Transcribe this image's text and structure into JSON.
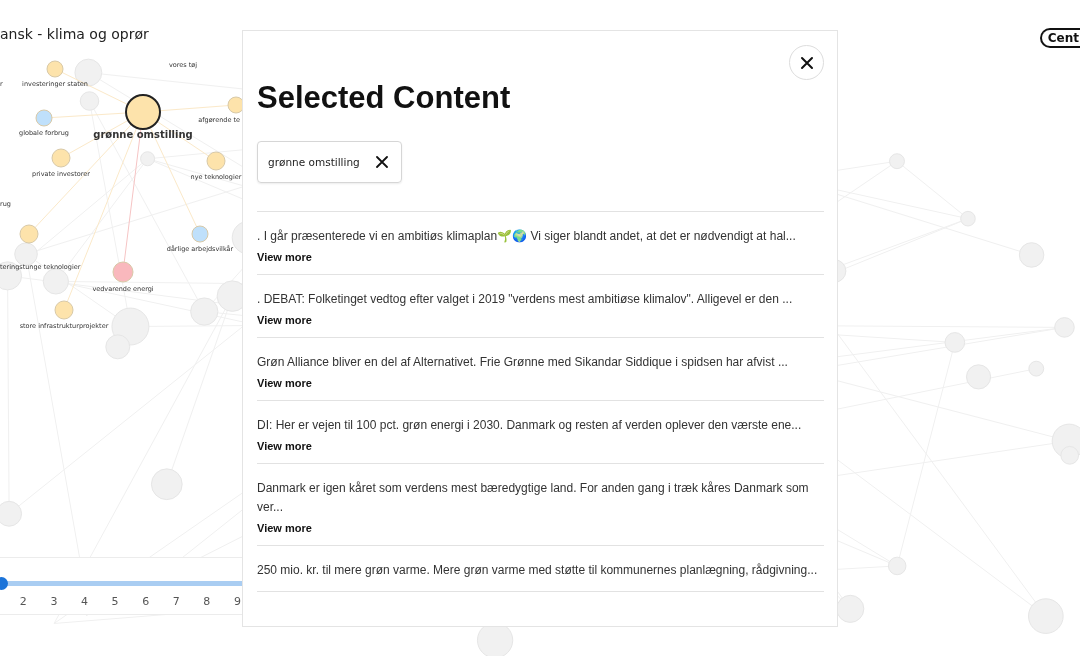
{
  "page_title": "ansk - klima og oprør",
  "center_button": "Cent",
  "graph": {
    "nodes": [
      {
        "label": "investeringer staten",
        "color": "#fde3ab",
        "selected": false
      },
      {
        "label": "vores tøj",
        "selected": false
      },
      {
        "label": "r",
        "selected": false
      },
      {
        "label": "globale forbrug",
        "color": "#bfe0fb",
        "selected": false
      },
      {
        "label": "grønne omstilling",
        "color": "#fde3ab",
        "selected": true
      },
      {
        "label": "afgørende te",
        "color": "#fde3ab",
        "selected": false
      },
      {
        "label": "private investorer",
        "color": "#fde3ab",
        "selected": false
      },
      {
        "label": "nye teknologier",
        "color": "#fde3ab",
        "selected": false
      },
      {
        "label": "rug",
        "selected": false
      },
      {
        "label": "teringstunge teknologier",
        "color": "#fde3ab",
        "selected": false
      },
      {
        "label": "dårlige arbejdsvilkår",
        "color": "#bfe0fb",
        "selected": false
      },
      {
        "label": "vedvarende energi",
        "color": "#f9b8bd",
        "selected": false
      },
      {
        "label": "store infrastrukturprojekter",
        "color": "#fde3ab",
        "selected": false
      }
    ]
  },
  "timeline": {
    "level": 0,
    "ticks": [
      "2",
      "3",
      "4",
      "5",
      "6",
      "7",
      "8",
      "9"
    ]
  },
  "modal": {
    "title": "Selected Content",
    "chips": [
      {
        "label": "grønne omstilling"
      }
    ],
    "items": [
      {
        "text": ". I går præsenterede vi en ambitiøs klimaplan🌱🌍 Vi siger blandt andet, at det er nødvendigt at hal...",
        "link": "View more"
      },
      {
        "text": ". DEBAT: Folketinget vedtog efter valget i 2019 \"verdens mest ambitiøse klimalov\". Alligevel er den ...",
        "link": "View more"
      },
      {
        "text": "Grøn Alliance bliver en del af Alternativet. Frie Grønne med Sikandar Siddique i spidsen har afvist ...",
        "link": "View more"
      },
      {
        "text": "DI: Her er vejen til 100 pct. grøn energi i 2030. Danmark og resten af verden oplever den værste ene...",
        "link": "View more"
      },
      {
        "text": "Danmark er igen kåret som verdens mest bæredygtige land. For anden gang i træk kåres Danmark som ver...",
        "link": "View more"
      },
      {
        "text": "250 mio. kr. til mere grøn varme. Mere grøn varme med støtte til kommunernes planlægning, rådgivning..."
      }
    ]
  }
}
